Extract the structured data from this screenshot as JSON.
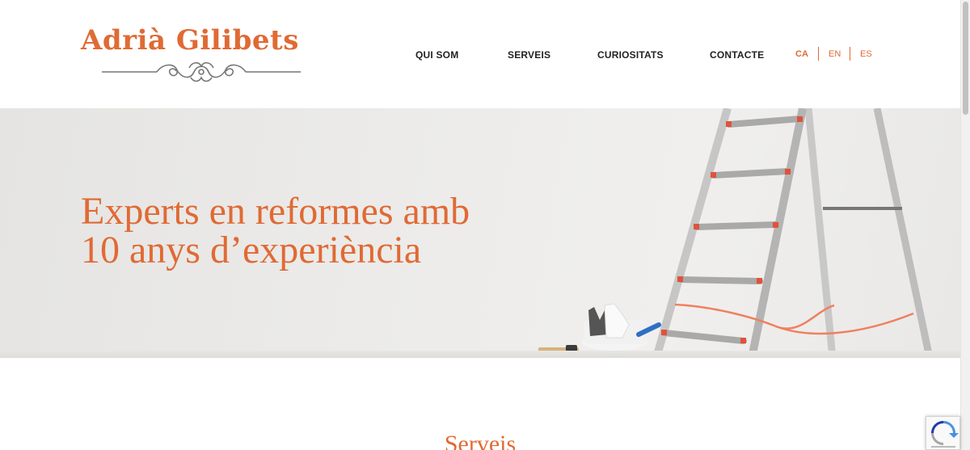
{
  "brand": {
    "name": "Adrià Gilibets",
    "accent": "#e06a34"
  },
  "nav": {
    "items": [
      {
        "label": "QUI SOM"
      },
      {
        "label": "SERVEIS"
      },
      {
        "label": "CURIOSITATS"
      },
      {
        "label": "CONTACTE"
      }
    ],
    "languages": [
      {
        "code": "CA",
        "active": true
      },
      {
        "code": "EN",
        "active": false
      },
      {
        "code": "ES",
        "active": false
      }
    ]
  },
  "hero": {
    "line1": "Experts en reformes amb",
    "line2": "10 anys d’experiència"
  },
  "section": {
    "title": "Serveis"
  },
  "icons": [
    "logo-flourish-icon",
    "recaptcha-icon"
  ]
}
